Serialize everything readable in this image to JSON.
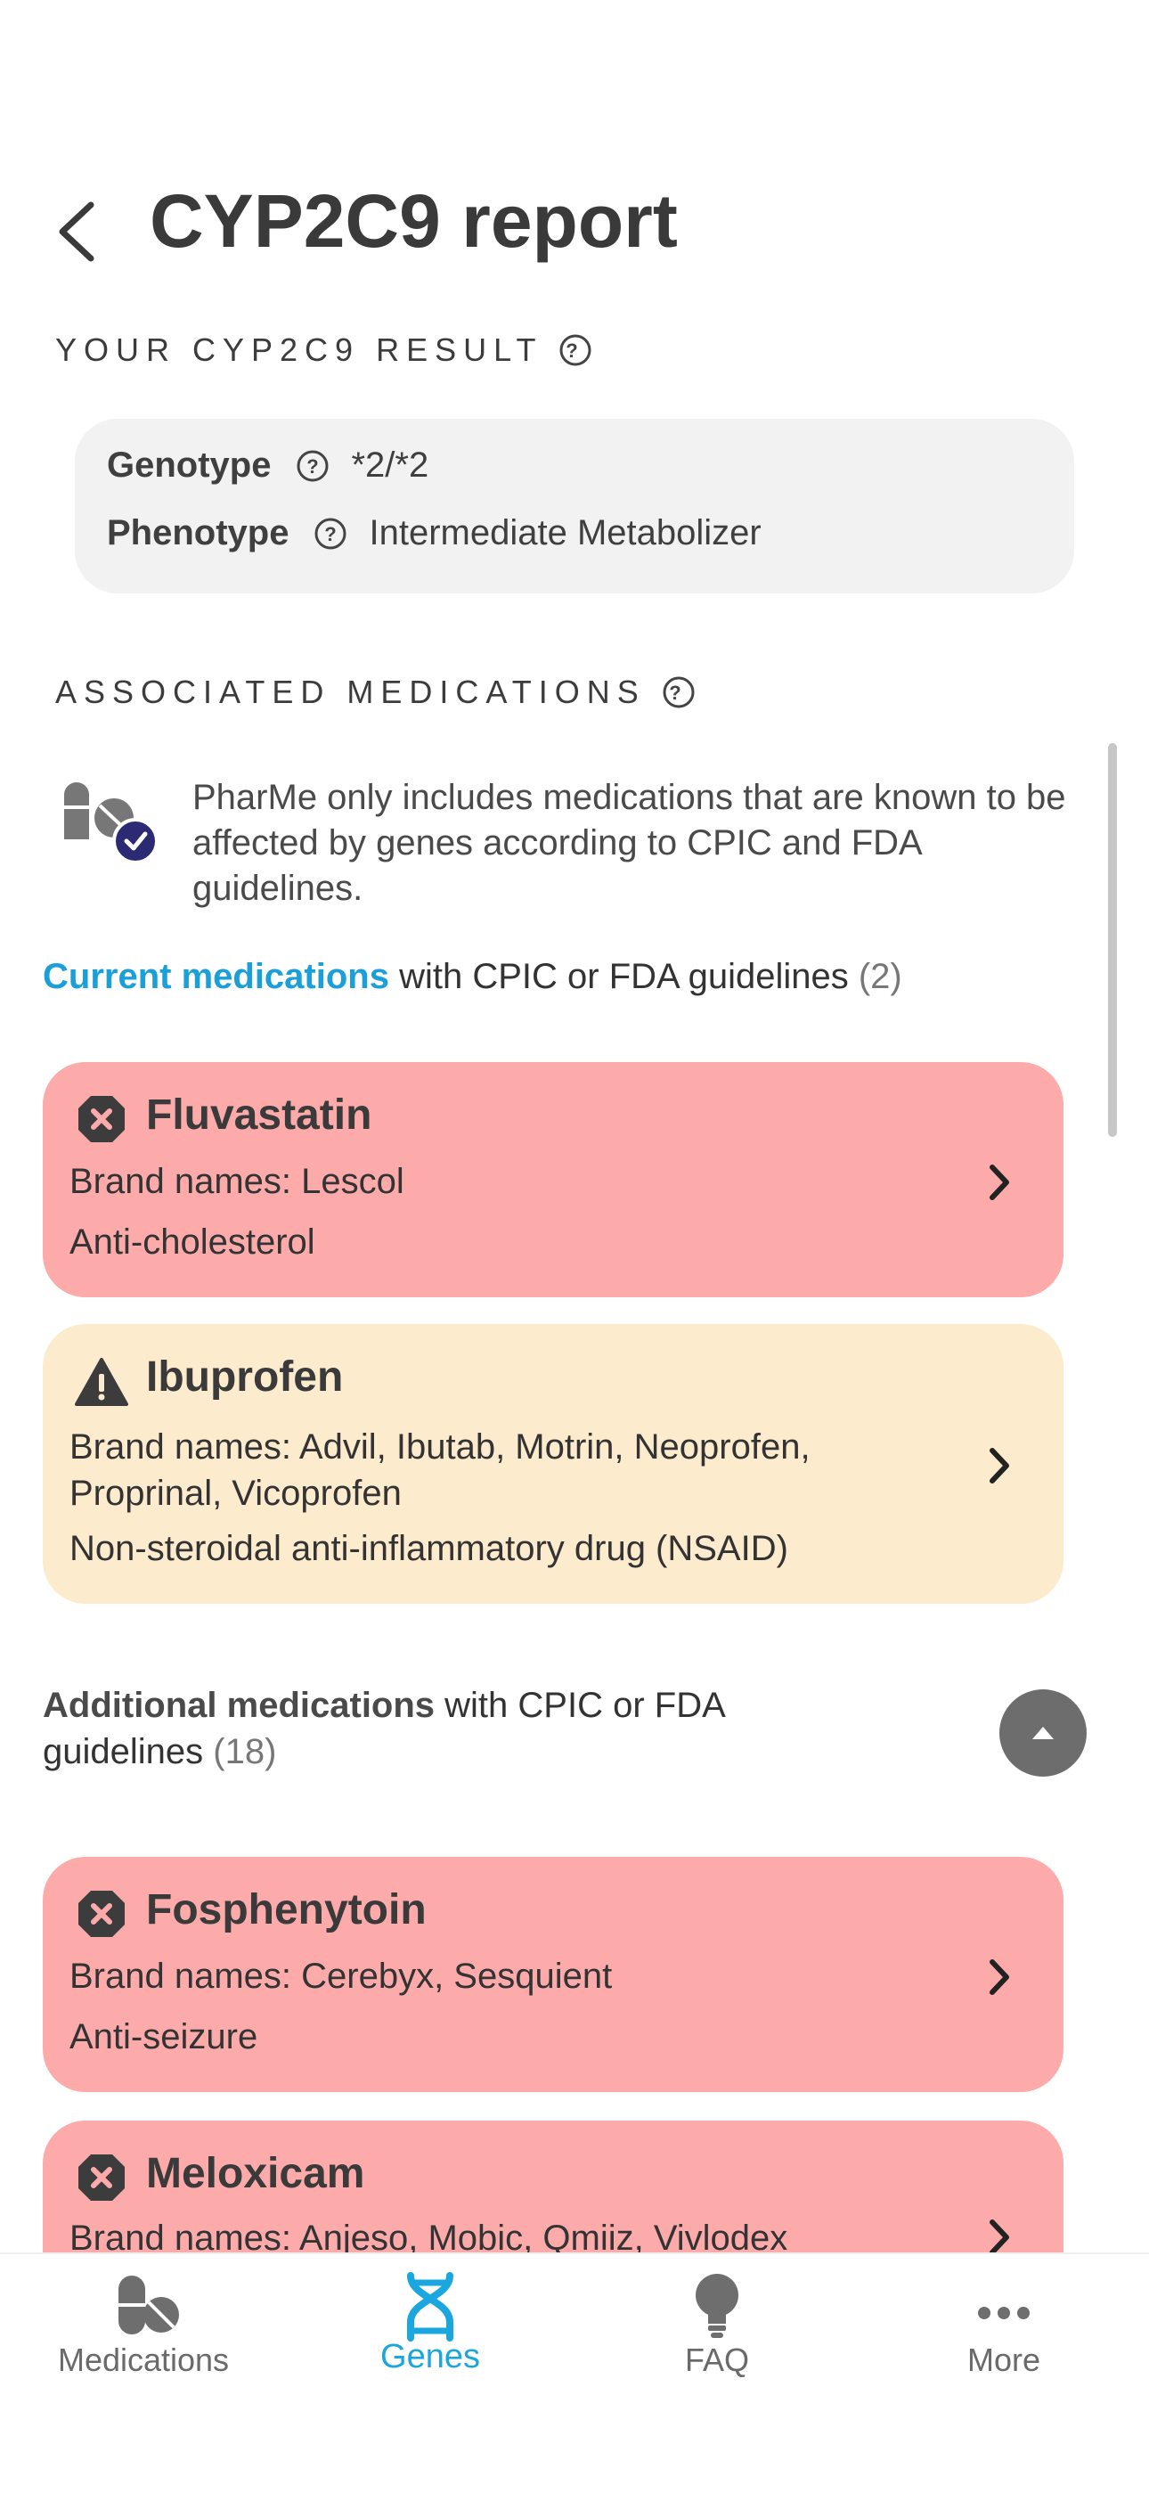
{
  "header": {
    "title": "CYP2C9 report"
  },
  "result_section": {
    "label": "YOUR CYP2C9 RESULT",
    "genotype_label": "Genotype",
    "genotype_value": "*2/*2",
    "phenotype_label": "Phenotype",
    "phenotype_value": "Intermediate Metabolizer"
  },
  "associated_section": {
    "label": "ASSOCIATED MEDICATIONS",
    "info": "PharMe only includes medications that are known to be affected by genes according to CPIC and FDA guidelines."
  },
  "current_medications": {
    "accent": "Current medications",
    "rest": " with CPIC or FDA guidelines",
    "count": "(2)",
    "items": [
      {
        "name": "Fluvastatin",
        "brands": "Brand names: Lescol",
        "category": "Anti-cholesterol",
        "status": "red"
      },
      {
        "name": "Ibuprofen",
        "brands": "Brand names: Advil, Ibutab, Motrin, Neoprofen, Proprinal, Vicoprofen",
        "category": "Non-steroidal anti-inflammatory drug (NSAID)",
        "status": "amber"
      }
    ]
  },
  "additional_medications": {
    "bold": "Additional medications",
    "rest": " with CPIC or FDA guidelines",
    "count": "(18)",
    "items": [
      {
        "name": "Fosphenytoin",
        "brands": "Brand names: Cerebyx, Sesquient",
        "category": "Anti-seizure",
        "status": "red"
      },
      {
        "name": "Meloxicam",
        "brands": "Brand names: Anjeso, Mobic, Qmiiz, Vivlodex",
        "status": "red"
      }
    ]
  },
  "bottom_nav": {
    "items": [
      {
        "label": "Medications",
        "icon": "pills-icon"
      },
      {
        "label": "Genes",
        "icon": "dna-icon",
        "active": true
      },
      {
        "label": "FAQ",
        "icon": "lightbulb-icon"
      },
      {
        "label": "More",
        "icon": "more-icon"
      }
    ]
  },
  "colors": {
    "accent": "#1a9fd8",
    "red_card": "#fdaaaa",
    "amber_card": "#fdebcd",
    "info_badge": "#2b2a72"
  }
}
